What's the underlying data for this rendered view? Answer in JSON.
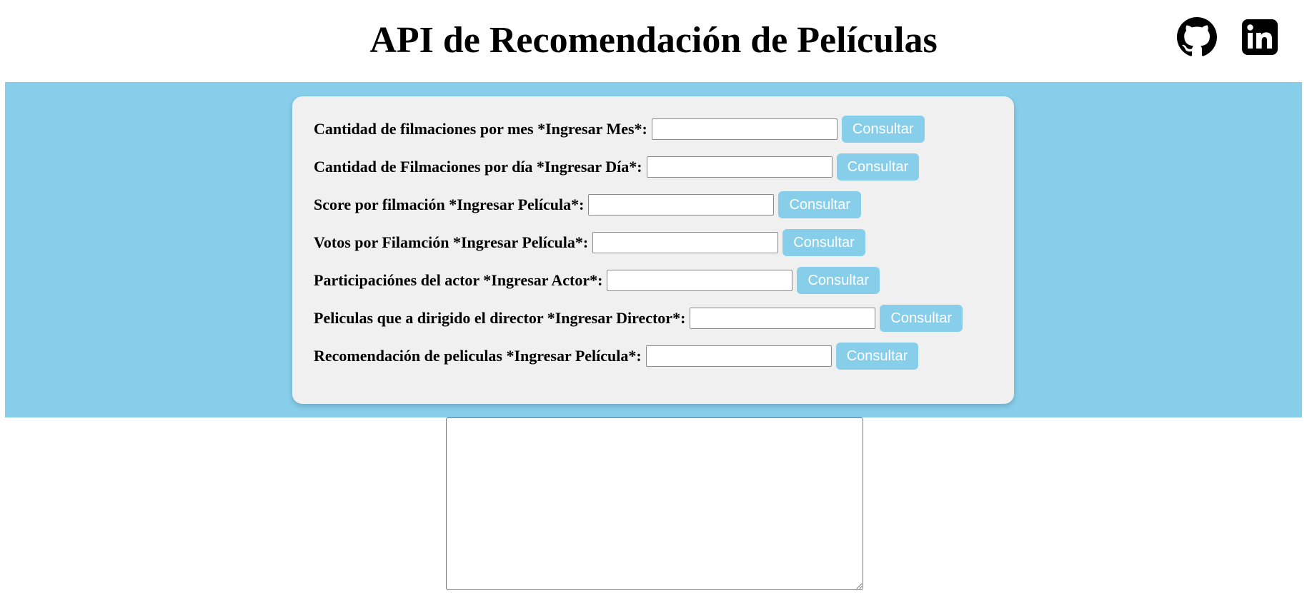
{
  "header": {
    "title": "API de Recomendación de Películas",
    "github_icon": "github-icon",
    "linkedin_icon": "linkedin-icon"
  },
  "colors": {
    "band_background": "#87ceeb",
    "card_background": "#f0f0f0",
    "button_background": "#87ceeb",
    "button_text": "#ffffff"
  },
  "form": {
    "rows": [
      {
        "label": "Cantidad de filmaciones por mes *Ingresar Mes*:",
        "value": "",
        "button": "Consultar"
      },
      {
        "label": "Cantidad de Filmaciones por día *Ingresar Día*:",
        "value": "",
        "button": "Consultar"
      },
      {
        "label": "Score por filmación *Ingresar Película*:",
        "value": "",
        "button": "Consultar"
      },
      {
        "label": "Votos por Filamción *Ingresar Película*:",
        "value": "",
        "button": "Consultar"
      },
      {
        "label": "Participaciónes del actor *Ingresar Actor*:",
        "value": "",
        "button": "Consultar"
      },
      {
        "label": "Peliculas que a dirigido el director *Ingresar Director*:",
        "value": "",
        "button": "Consultar"
      },
      {
        "label": "Recomendación de peliculas *Ingresar Película*:",
        "value": "",
        "button": "Consultar"
      }
    ]
  },
  "result": {
    "value": ""
  }
}
